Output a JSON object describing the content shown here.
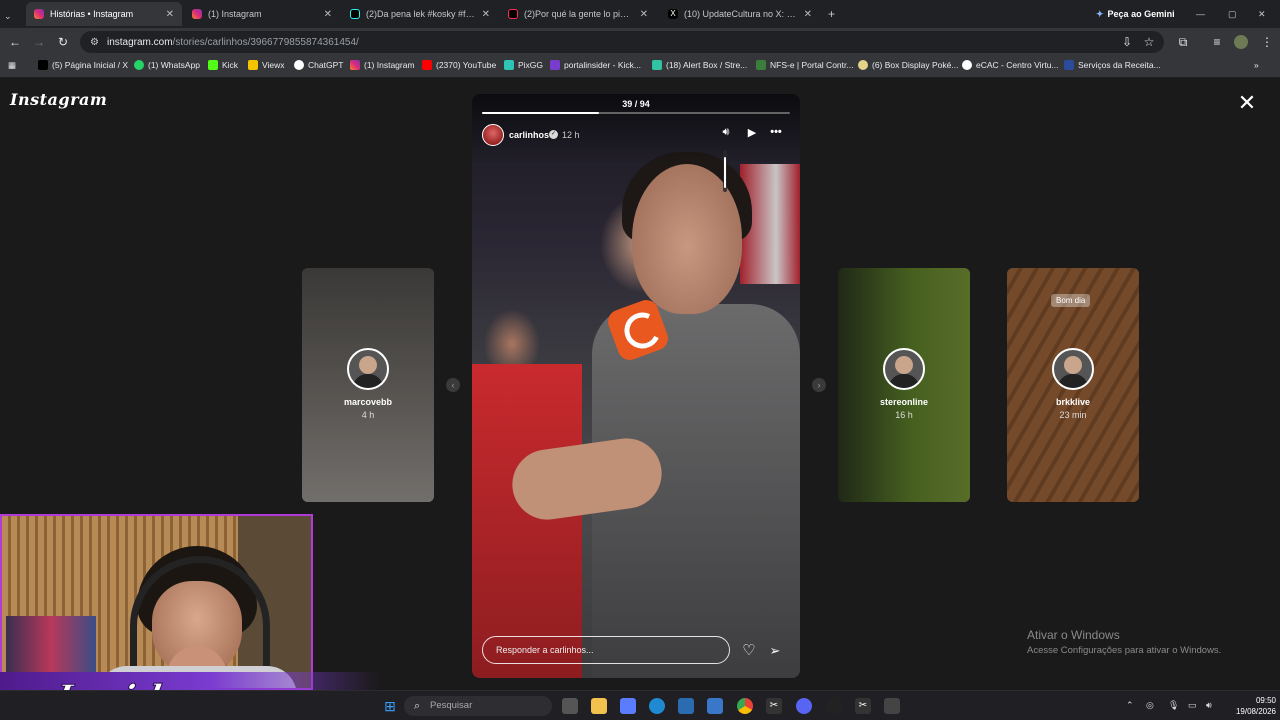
{
  "browser": {
    "tabs": [
      {
        "label": "Histórias • Instagram",
        "active": true
      },
      {
        "label": "(1) Instagram"
      },
      {
        "label": "(2)Da pena lek #kosky #fontin..."
      },
      {
        "label": "(2)Por qué la gente lo pide, Par..."
      },
      {
        "label": "(10) UpdateCultura no X: \"May..."
      }
    ],
    "new_tab": "+",
    "gemini": "Peça ao Gemini",
    "url_host": "instagram.com",
    "url_path": "/stories/carlinhos/3966779855874361454/",
    "bookmarks": [
      "(5) Página Inicial / X",
      "(1) WhatsApp",
      "Kick",
      "Viewx",
      "ChatGPT",
      "(1) Instagram",
      "(2370) YouTube",
      "PixGG",
      "portalinsider - Kick...",
      "(18) Alert Box / Stre...",
      "NFS-e | Portal Contr...",
      "(6) Box Display Poké...",
      "eCAC - Centro Virtu...",
      "Serviços da Receita..."
    ]
  },
  "instagram": {
    "logo": "Instagram",
    "close": "✕",
    "story": {
      "counter": "39 / 94",
      "progress": 0.38,
      "username": "carlinhos",
      "time": "12 h",
      "volume": 0.9,
      "reply_placeholder": "Responder a carlinhos..."
    },
    "side_stories": [
      {
        "username": "marcovebb",
        "time": "4 h",
        "bg": "#8e8a86"
      },
      {
        "username": "stereonline",
        "time": "16 h",
        "bg": "#5b7a3c"
      },
      {
        "username": "brkklive",
        "time": "23 min",
        "bg": "#8d5a34",
        "badge": "Bom dia"
      }
    ]
  },
  "windows": {
    "activate_title": "Ativar o Windows",
    "activate_sub": "Acesse Configurações para ativar o Windows.",
    "search_placeholder": "Pesquisar",
    "clock_time": "09:50",
    "clock_date": "19/08/2026"
  },
  "overlay": {
    "brand": "Insider"
  },
  "colors": {
    "accent_purple": "#7a3bcf",
    "webcam_border": "#b13bd6"
  }
}
